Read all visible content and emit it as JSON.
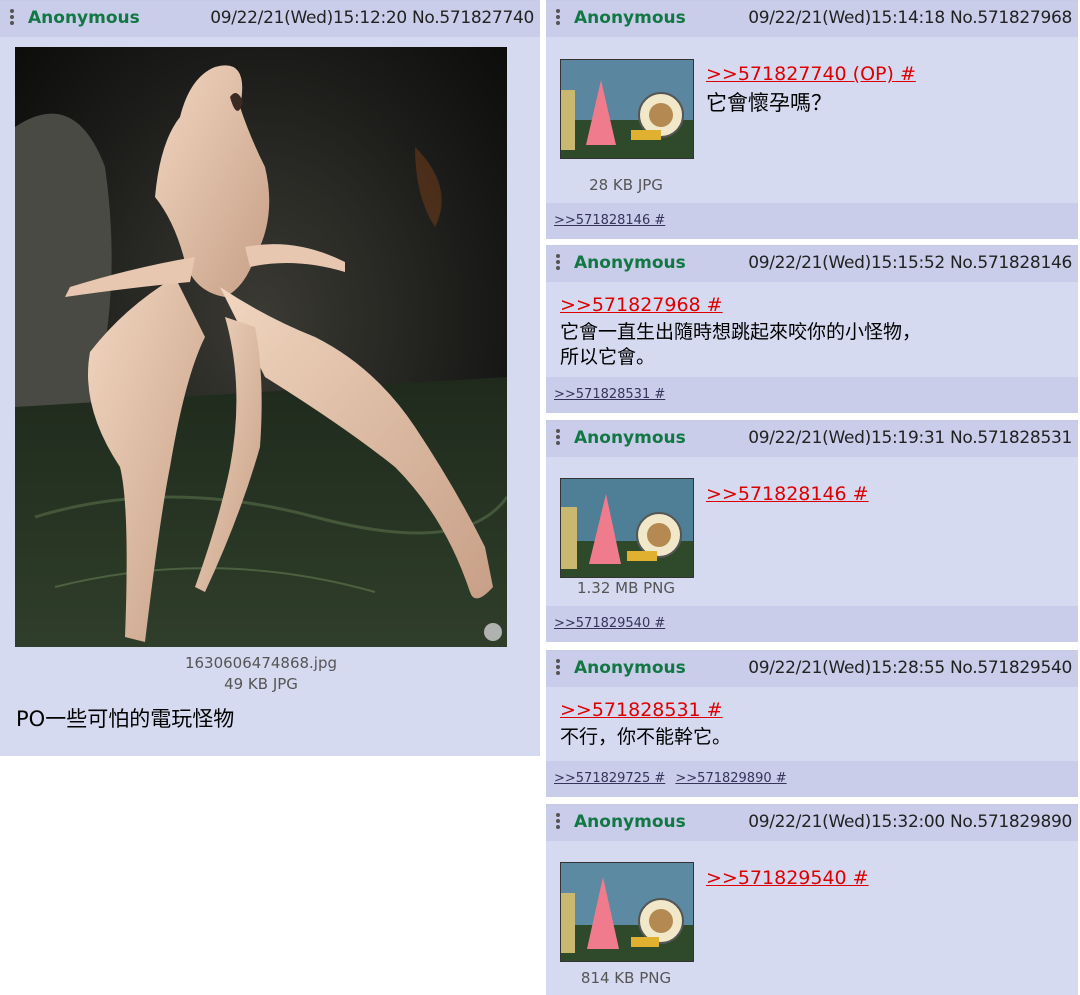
{
  "op": {
    "name": "Anonymous",
    "datetime": "09/22/21(Wed)15:12:20 No.571827740",
    "filename": "1630606474868.jpg",
    "filesize": "49 KB JPG",
    "message": "PO一些可怕的電玩怪物"
  },
  "replies": [
    {
      "name": "Anonymous",
      "datetime": "09/22/21(Wed)15:14:18 No.571827968",
      "quote": ">>571827740 (OP) #",
      "message": "它會懷孕嗎？",
      "filesize": "28 KB JPG",
      "backlinks": [
        ">>571828146 #"
      ]
    },
    {
      "name": "Anonymous",
      "datetime": "09/22/21(Wed)15:15:52 No.571828146",
      "quote": ">>571827968 #",
      "message_lines": [
        "它會一直生出隨時想跳起來咬你的小怪物，",
        "所以它會。"
      ],
      "backlinks": [
        ">>571828531 #"
      ]
    },
    {
      "name": "Anonymous",
      "datetime": "09/22/21(Wed)15:19:31 No.571828531",
      "quote": ">>571828146 #",
      "filesize": "1.32 MB PNG",
      "backlinks": [
        ">>571829540 #"
      ]
    },
    {
      "name": "Anonymous",
      "datetime": "09/22/21(Wed)15:28:55 No.571829540",
      "quote": ">>571828531 #",
      "message": "不行，你不能幹它。",
      "backlinks": [
        ">>571829725 #",
        ">>571829890 #"
      ]
    },
    {
      "name": "Anonymous",
      "datetime": "09/22/21(Wed)15:32:00 No.571829890",
      "quote": ">>571829540 #",
      "filesize": "814 KB PNG"
    }
  ]
}
